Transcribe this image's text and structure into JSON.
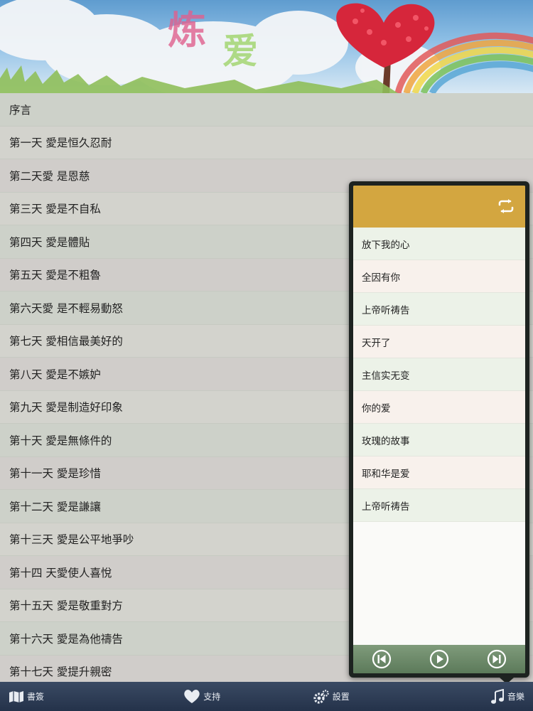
{
  "banner": {
    "title_char_1": "炼",
    "title_char_2": "爱"
  },
  "chapters": [
    "序言",
    "第一天 愛是恒久忍耐",
    "第二天愛 是恩慈",
    "第三天 愛是不自私",
    "第四天 愛是體貼",
    "第五天 愛是不粗魯",
    "第六天愛 是不輕易動怒",
    "第七天 愛相信最美好的",
    "第八天 愛是不嫉妒",
    "第九天 愛是制造好印象",
    "第十天 愛是無條件的",
    "第十一天 愛是珍惜",
    "第十二天 愛是謙讓",
    "第十三天 愛是公平地爭吵",
    "第十四 天愛使人喜悅",
    "第十五天 愛是敬重對方",
    "第十六天 愛是為他禱告",
    "第十七天 愛提升親密"
  ],
  "music_panel": {
    "songs": [
      "放下我的心",
      "全因有你",
      "上帝听祷告",
      "天开了",
      "主信实无变",
      "你的爱",
      "玫瑰的故事",
      "耶和华是爱",
      "上帝听祷告"
    ],
    "header_color": "#d3a640"
  },
  "tabbar": {
    "bookmarks": "書簽",
    "support": "支持",
    "settings": "設置",
    "music": "音樂"
  }
}
